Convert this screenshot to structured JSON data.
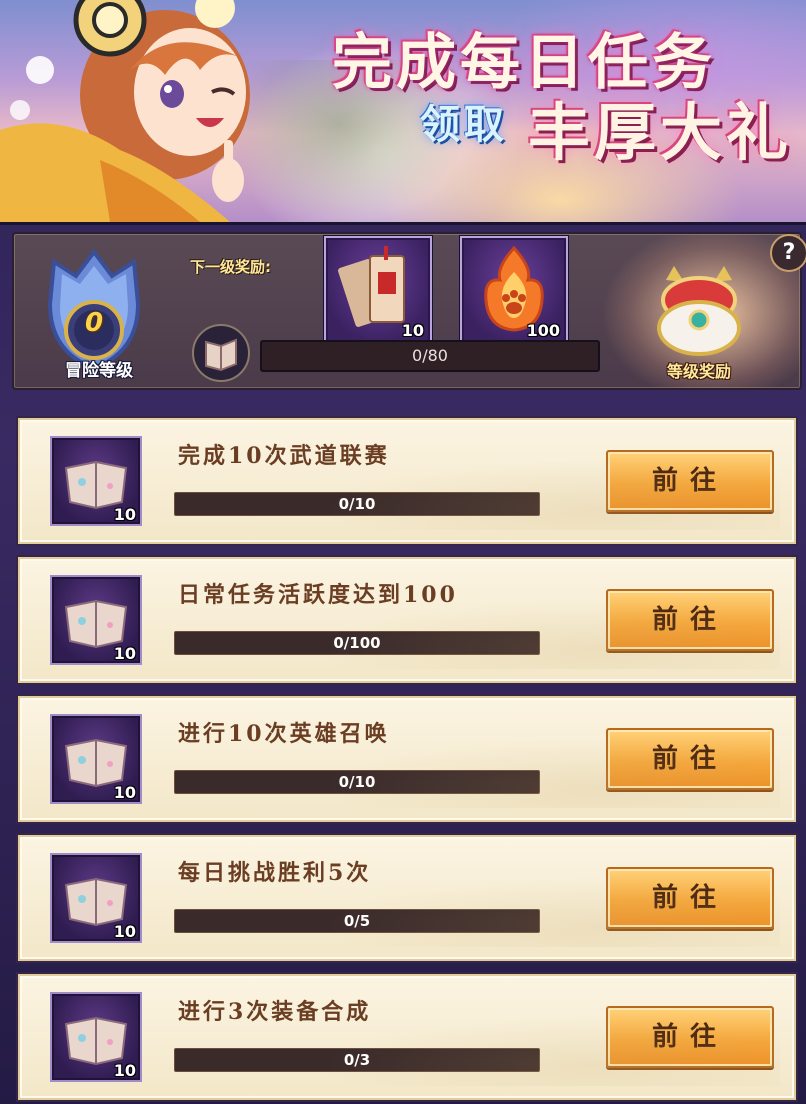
{
  "banner": {
    "title_line1": "完成每日任务",
    "title_line2a": "领取",
    "title_line2b": "丰厚大礼"
  },
  "level": {
    "value": "0",
    "label": "冒险等级",
    "next_reward_label": "下一级奖励:",
    "rewards": [
      {
        "icon": "ticket-icon",
        "qty": "10"
      },
      {
        "icon": "flame-paw-icon",
        "qty": "100"
      }
    ],
    "progress_text": "0/80",
    "progress_fraction": 0,
    "chest_label": "等级奖励",
    "help": "?"
  },
  "tasks": [
    {
      "title": "完成10次武道联赛",
      "reward_qty": "10",
      "progress_text": "0/10",
      "progress_fraction": 0,
      "button": "前往"
    },
    {
      "title": "日常任务活跃度达到100",
      "reward_qty": "10",
      "progress_text": "0/100",
      "progress_fraction": 0,
      "button": "前往"
    },
    {
      "title": "进行10次英雄召唤",
      "reward_qty": "10",
      "progress_text": "0/10",
      "progress_fraction": 0,
      "button": "前往"
    },
    {
      "title": "每日挑战胜利5次",
      "reward_qty": "10",
      "progress_text": "0/5",
      "progress_fraction": 0,
      "button": "前往"
    },
    {
      "title": "进行3次装备合成",
      "reward_qty": "10",
      "progress_text": "0/3",
      "progress_fraction": 0,
      "button": "前往"
    }
  ],
  "colors": {
    "accent_orange": "#f6a83c",
    "title_brown": "#6b3e24",
    "panel_purple": "#3a2a63"
  }
}
